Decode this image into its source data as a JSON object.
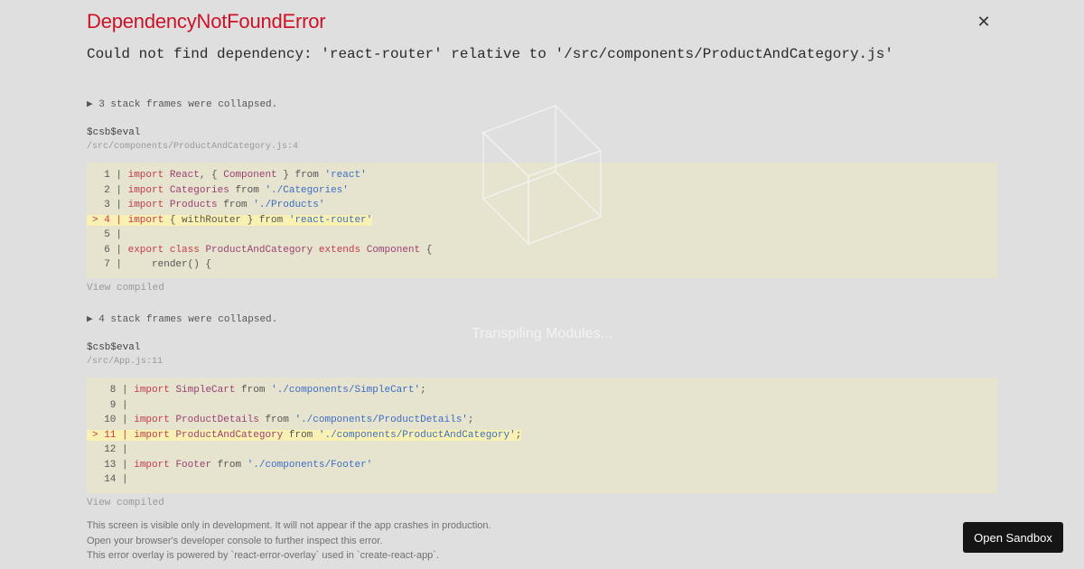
{
  "error": {
    "title": "DependencyNotFoundError",
    "message": "Could not find dependency: 'react-router' relative to '/src/components/ProductAndCategory.js'"
  },
  "close_icon": "close-icon",
  "stack": [
    {
      "collapsed_text": "▶ 3 stack frames were collapsed.",
      "function_name": "$csb$eval",
      "location": "/src/components/ProductAndCategory.js:4",
      "view_compiled_label": "View compiled",
      "lines": [
        {
          "num": "1",
          "highlight": false,
          "tokens": [
            [
              "kw",
              "import"
            ],
            [
              "pl",
              " "
            ],
            [
              "id",
              "React"
            ],
            [
              "pl",
              ", { "
            ],
            [
              "id",
              "Component"
            ],
            [
              "pl",
              " } from "
            ],
            [
              "str",
              "'react'"
            ]
          ]
        },
        {
          "num": "2",
          "highlight": false,
          "tokens": [
            [
              "kw",
              "import"
            ],
            [
              "pl",
              " "
            ],
            [
              "id",
              "Categories"
            ],
            [
              "pl",
              " from "
            ],
            [
              "str",
              "'./Categories'"
            ]
          ]
        },
        {
          "num": "3",
          "highlight": false,
          "tokens": [
            [
              "kw",
              "import"
            ],
            [
              "pl",
              " "
            ],
            [
              "id",
              "Products"
            ],
            [
              "pl",
              " from "
            ],
            [
              "str",
              "'./Products'"
            ]
          ]
        },
        {
          "num": "4",
          "highlight": true,
          "tokens": [
            [
              "kw",
              "import"
            ],
            [
              "pl",
              " { withRouter } from "
            ],
            [
              "str",
              "'react-router'"
            ]
          ]
        },
        {
          "num": "5",
          "highlight": false,
          "tokens": []
        },
        {
          "num": "6",
          "highlight": false,
          "tokens": [
            [
              "kw",
              "export"
            ],
            [
              "pl",
              " "
            ],
            [
              "kw",
              "class"
            ],
            [
              "pl",
              " "
            ],
            [
              "id",
              "ProductAndCategory"
            ],
            [
              "pl",
              " "
            ],
            [
              "kw",
              "extends"
            ],
            [
              "pl",
              " "
            ],
            [
              "id",
              "Component"
            ],
            [
              "pl",
              " {"
            ]
          ]
        },
        {
          "num": "7",
          "highlight": false,
          "tokens": [
            [
              "pl",
              "    render() {"
            ]
          ]
        }
      ]
    },
    {
      "collapsed_text": "▶ 4 stack frames were collapsed.",
      "function_name": "$csb$eval",
      "location": "/src/App.js:11",
      "view_compiled_label": "View compiled",
      "lines": [
        {
          "num": "8",
          "highlight": false,
          "tokens": [
            [
              "kw",
              "import"
            ],
            [
              "pl",
              " "
            ],
            [
              "id",
              "SimpleCart"
            ],
            [
              "pl",
              " from "
            ],
            [
              "str",
              "'./components/SimpleCart'"
            ],
            [
              "pl",
              ";"
            ]
          ]
        },
        {
          "num": "9",
          "highlight": false,
          "tokens": []
        },
        {
          "num": "10",
          "highlight": false,
          "tokens": [
            [
              "kw",
              "import"
            ],
            [
              "pl",
              " "
            ],
            [
              "id",
              "ProductDetails"
            ],
            [
              "pl",
              " from "
            ],
            [
              "str",
              "'./components/ProductDetails'"
            ],
            [
              "pl",
              ";"
            ]
          ]
        },
        {
          "num": "11",
          "highlight": true,
          "tokens": [
            [
              "kw",
              "import"
            ],
            [
              "pl",
              " "
            ],
            [
              "id",
              "ProductAndCategory"
            ],
            [
              "pl",
              " from "
            ],
            [
              "str",
              "'./components/ProductAndCategory'"
            ],
            [
              "pl",
              ";"
            ]
          ]
        },
        {
          "num": "12",
          "highlight": false,
          "tokens": []
        },
        {
          "num": "13",
          "highlight": false,
          "tokens": [
            [
              "kw",
              "import"
            ],
            [
              "pl",
              " "
            ],
            [
              "id",
              "Footer"
            ],
            [
              "pl",
              " from "
            ],
            [
              "str",
              "'./components/Footer'"
            ]
          ]
        },
        {
          "num": "14",
          "highlight": false,
          "tokens": []
        }
      ]
    }
  ],
  "footer": {
    "line1": "This screen is visible only in development. It will not appear if the app crashes in production.",
    "line2": "Open your browser's developer console to further inspect this error.",
    "line3": "This error overlay is powered by `react-error-overlay` used in `create-react-app`."
  },
  "loader": {
    "icon": "cube-icon",
    "text": "Transpiling Modules..."
  },
  "open_sandbox_label": "Open Sandbox"
}
